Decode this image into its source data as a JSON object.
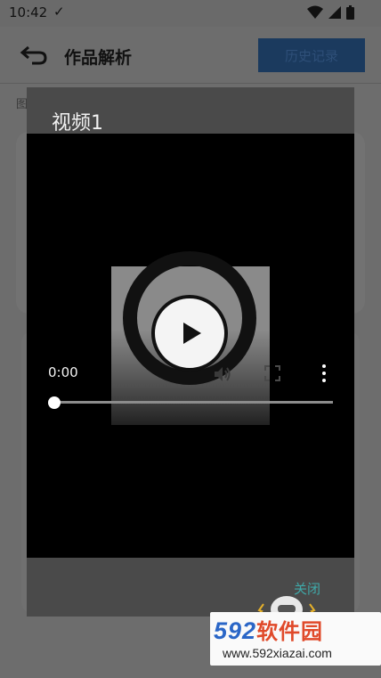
{
  "status_bar": {
    "time": "10:42",
    "check_glyph": "✓",
    "icons": [
      "wifi-icon",
      "signal-icon",
      "battery-icon"
    ]
  },
  "app_bar": {
    "title": "作品解析",
    "history_label": "历史记录",
    "back_icon": "back-arrow-icon"
  },
  "background": {
    "label": "图"
  },
  "dialog": {
    "title": "视频1",
    "close_label": "关闭"
  },
  "video_player": {
    "current_time": "0:00",
    "progress": 0,
    "icons": [
      "play-icon",
      "volume-icon",
      "fullscreen-icon",
      "more-options-icon"
    ]
  },
  "watermark": {
    "logo_digits": "592",
    "logo_text": "软件园",
    "url": "www.592xiazai.com"
  },
  "colors": {
    "accent": "#3fa9a9",
    "history_button": "#1b3a5e",
    "dialog_bg": "#4a4a4a",
    "logo_blue": "#2a66c7",
    "logo_red": "#e04a2a"
  }
}
